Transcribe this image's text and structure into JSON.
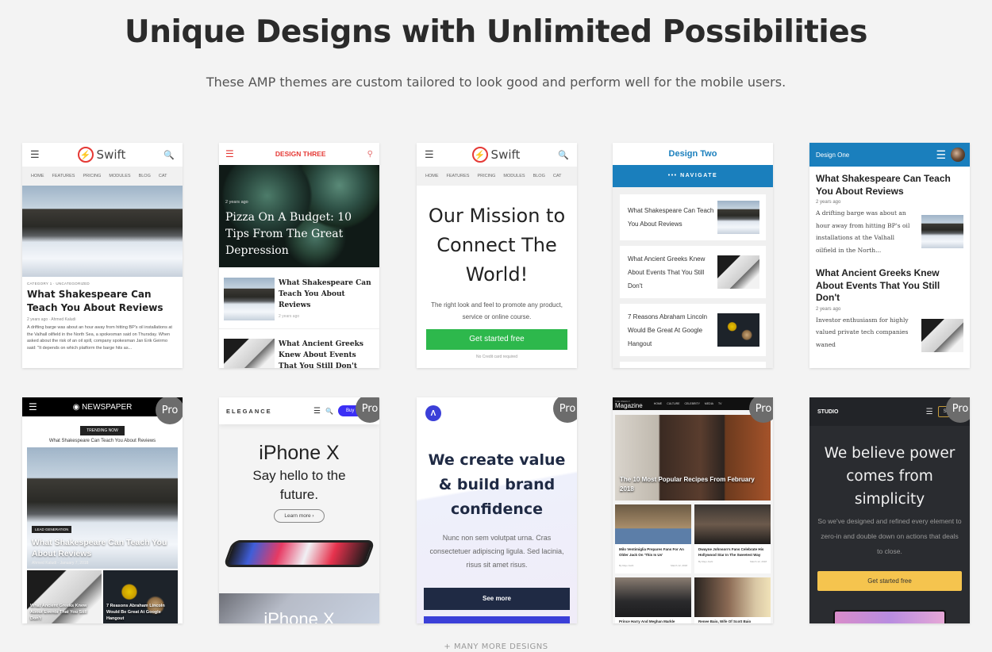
{
  "page": {
    "title": "Unique Designs with Unlimited Possibilities",
    "subtitle": "These AMP themes are custom tailored to look good and perform well for the mobile users.",
    "more_designs": "+ MANY MORE DESIGNS",
    "pro_badge": "Pro"
  },
  "themes": {
    "swift_blog": {
      "brand": "Swift",
      "nav": [
        "HOME",
        "FEATURES",
        "PRICING",
        "MODULES",
        "BLOG",
        "CAT"
      ],
      "category": "CATEGORY 1 · UNCATEGORIZED",
      "headline": "What Shakespeare Can Teach You About Reviews",
      "meta": "2 years ago · Ahmed Kaludi",
      "excerpt": "A drifting barge was about an hour away from hitting BP's oil installations at the Valhall oilfield in the North Sea, a spokesman said on Thursday. When asked about the risk of an oil spill, company spokesman Jan Erik Geirmo said: \"It depends on which platform the barge hits as..."
    },
    "design_three": {
      "title": "DESIGN THREE",
      "hero_meta": "2 years ago",
      "hero_headline": "Pizza On A Budget: 10 Tips From The Great Depression",
      "items": [
        {
          "headline": "What Shakespeare Can Teach You About Reviews",
          "meta": "2 years ago"
        },
        {
          "headline": "What Ancient Greeks Knew About Events That You Still Don't",
          "meta": ""
        }
      ]
    },
    "swift_landing": {
      "brand": "Swift",
      "nav": [
        "HOME",
        "FEATURES",
        "PRICING",
        "MODULES",
        "BLOG",
        "CAT"
      ],
      "headline": "Our Mission to Connect The World!",
      "text": "The right look and feel to promote any product, service or online course.",
      "cta": "Get started free",
      "note": "No Credit card required",
      "accent": "#2db84c"
    },
    "design_two": {
      "title": "Design Two",
      "navigate": "••• NAVIGATE",
      "accent": "#1a7fbd",
      "items": [
        "What Shakespeare Can Teach You About Reviews",
        "What Ancient Greeks Knew About Events That You Still Don't",
        "7 Reasons Abraham Lincoln Would Be Great At Google Hangout"
      ]
    },
    "design_one": {
      "title": "Design One",
      "accent": "#1a7fbd",
      "items": [
        {
          "headline": "What Shakespeare Can Teach You About Reviews",
          "meta": "2 years ago",
          "excerpt": "A drifting barge was about an hour away from hitting BP's oil installations at the Valhall oilfield in the North..."
        },
        {
          "headline": "What Ancient Greeks Knew About Events That You Still Don't",
          "meta": "2 years ago",
          "excerpt": "Investor enthusiasm for highly valued private tech companies waned"
        }
      ]
    },
    "newspaper": {
      "brand": "NEWSPAPER",
      "trending_label": "TRENDING NOW",
      "trending": "What Shakespeare Can Teach You About Reviews",
      "tag": "LEAD GENERATION",
      "headline": "What Shakespeare Can Teach You About Reviews",
      "meta": "Ahmed Kaludi - January 7, 2018",
      "tiles": [
        "What Ancient Greeks Knew About Events That You Still Don't",
        "7 Reasons Abraham Lincoln Would Be Great At Google Hangout"
      ]
    },
    "elegance": {
      "brand": "ELEGANCE",
      "buy": "Buy Now",
      "headline": "iPhone X",
      "subhead": "Say hello to the future.",
      "learn_more": "Learn more ›",
      "footer_text": "iPhone X"
    },
    "agency": {
      "headline": "We create value & build brand confidence",
      "text": "Nunc non sem volutpat urna. Cras consectetuer adipiscing ligula. Sed lacinia, risus sit amet risus.",
      "cta": "See more",
      "accent": "#3b3fd8"
    },
    "magazine": {
      "kicker": "THE WEEKLY",
      "brand": "Magazine",
      "nav": [
        "HOME",
        "CULTURE",
        "CELEBRITY",
        "MEDIA",
        "TV"
      ],
      "hero_headline": "The 10 Most Popular Recipes From February 2018",
      "tiles": [
        {
          "headline": "Milo Ventimiglia Prepares Fans For An Older Jack On 'This Is Us'",
          "author": "By Raju Joshi",
          "date": "March 12, 2018"
        },
        {
          "headline": "Dwayne Johnson's Fans Celebrate His Hollywood Star In The Sweetest Way",
          "author": "By Raju Joshi",
          "date": "March 12, 2018"
        },
        {
          "headline": "Prince Harry And Meghan Markle",
          "author": "",
          "date": ""
        },
        {
          "headline": "Renee Baio, Wife Of Scott Baio",
          "author": "",
          "date": ""
        }
      ]
    },
    "studio": {
      "brand": "STUDIO",
      "signin": "Sign in",
      "headline": "We believe power comes from simplicity",
      "text": "So we've designed and refined every element to zero-in and double down on actions that deals to close.",
      "cta": "Get started free",
      "accent": "#f5c44e"
    }
  }
}
